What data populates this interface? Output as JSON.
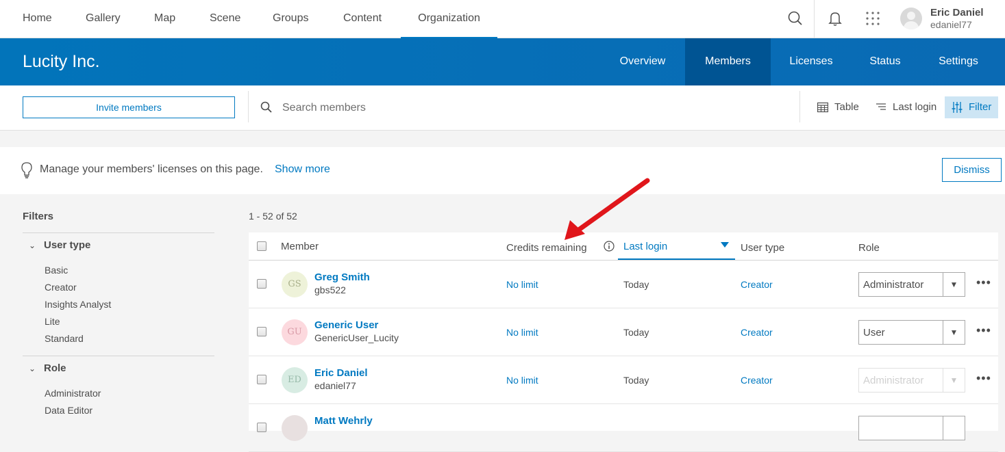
{
  "topnav": {
    "tabs": [
      "Home",
      "Gallery",
      "Map",
      "Scene",
      "Groups",
      "Content",
      "Organization"
    ],
    "active_tab": "Organization",
    "user": {
      "name": "Eric Daniel",
      "username": "edaniel77"
    }
  },
  "banner": {
    "org_name": "Lucity Inc.",
    "tabs": [
      "Overview",
      "Members",
      "Licenses",
      "Status",
      "Settings"
    ],
    "active_tab": "Members"
  },
  "toolbar": {
    "invite_label": "Invite members",
    "search_placeholder": "Search members",
    "view_label": "Table",
    "sort_label": "Last login",
    "filter_label": "Filter"
  },
  "info": {
    "message": "Manage your members' licenses on this page.",
    "show_more": "Show more",
    "dismiss": "Dismiss"
  },
  "filters": {
    "title": "Filters",
    "groups": [
      {
        "label": "User type",
        "items": [
          "Basic",
          "Creator",
          "Insights Analyst",
          "Lite",
          "Standard"
        ]
      },
      {
        "label": "Role",
        "items": [
          "Administrator",
          "Data Editor"
        ]
      }
    ]
  },
  "table": {
    "count": "1 - 52 of 52",
    "columns": {
      "member": "Member",
      "credits": "Credits remaining",
      "last_login": "Last login",
      "user_type": "User type",
      "role": "Role"
    },
    "rows": [
      {
        "initials": "GS",
        "name": "Greg Smith",
        "username": "gbs522",
        "credits": "No limit",
        "last_login": "Today",
        "user_type": "Creator",
        "role": "Administrator",
        "avatar_bg": "#eef2d9",
        "avatar_fg": "#a9b08a"
      },
      {
        "initials": "GU",
        "name": "Generic User",
        "username": "GenericUser_Lucity",
        "credits": "No limit",
        "last_login": "Today",
        "user_type": "Creator",
        "role": "User",
        "avatar_bg": "#fcd9de",
        "avatar_fg": "#d99aa6"
      },
      {
        "initials": "ED",
        "name": "Eric Daniel",
        "username": "edaniel77",
        "credits": "No limit",
        "last_login": "Today",
        "user_type": "Creator",
        "role": "Administrator",
        "avatar_bg": "#d8ece3",
        "avatar_fg": "#96b9a8"
      },
      {
        "initials": "",
        "name": "Matt Wehrly",
        "username": "",
        "credits": "",
        "last_login": "",
        "user_type": "",
        "role": "",
        "avatar_bg": "#e8e0e0",
        "avatar_fg": "#b0a0a0"
      }
    ]
  },
  "colors": {
    "accent": "#0079c1",
    "banner": "#0274ba",
    "active_banner_tab": "#005493",
    "annotation_arrow": "#e0161b"
  }
}
